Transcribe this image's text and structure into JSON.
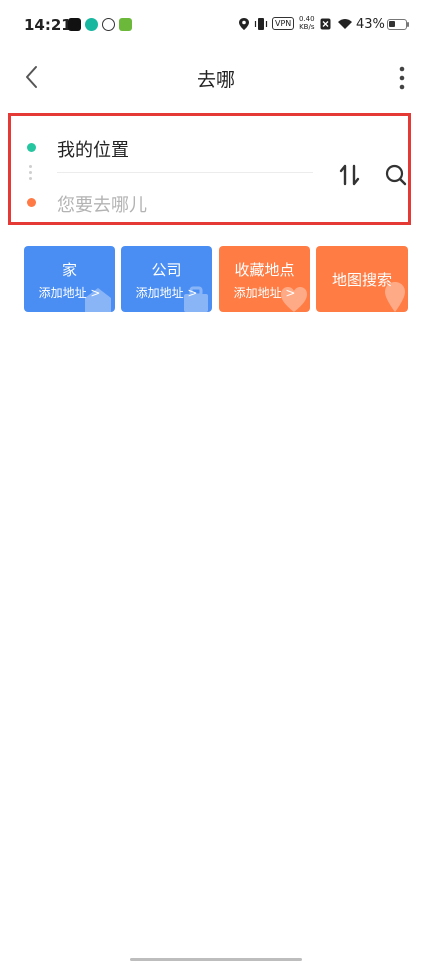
{
  "status_bar": {
    "time": "14:21",
    "vpn": "VPN",
    "speed_value": "0.40",
    "speed_unit": "KB/s",
    "battery": "43%",
    "battery_level": 0.43
  },
  "header": {
    "title": "去哪"
  },
  "route": {
    "from": "我的位置",
    "to_placeholder": "您要去哪儿"
  },
  "shortcuts": [
    {
      "title": "家",
      "subtitle": "添加地址 >"
    },
    {
      "title": "公司",
      "subtitle": "添加地址 >"
    },
    {
      "title": "收藏地点",
      "subtitle": "添加地址 >"
    },
    {
      "title": "地图搜索"
    }
  ],
  "colors": {
    "blue_tile": "#4b8ef3",
    "orange_tile": "#ff7d45",
    "highlight_border": "#e53935",
    "from_dot": "#26c6a0",
    "to_dot": "#ff7a45"
  }
}
